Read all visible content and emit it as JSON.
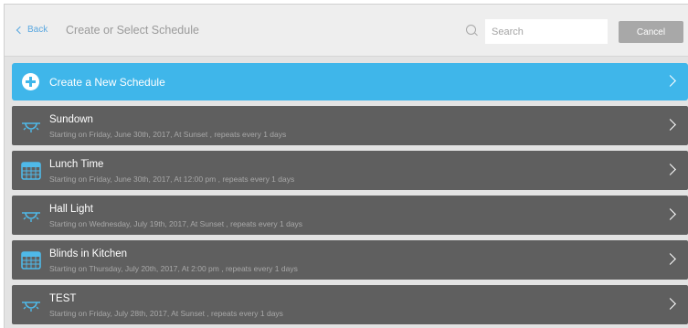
{
  "header": {
    "back_label": "Back",
    "title": "Create or Select Schedule",
    "search_placeholder": "Search",
    "cancel_label": "Cancel"
  },
  "create": {
    "label": "Create a New Schedule"
  },
  "schedules": [
    {
      "name": "Sundown",
      "detail": "Starting on Friday, June 30th, 2017, At Sunset , repeats every 1 days",
      "icon": "sunset-icon"
    },
    {
      "name": "Lunch Time",
      "detail": "Starting on Friday, June 30th, 2017, At 12:00 pm , repeats every 1 days",
      "icon": "calendar-icon"
    },
    {
      "name": "Hall Light",
      "detail": "Starting on Wednesday, July 19th, 2017, At Sunset , repeats every 1 days",
      "icon": "sunset-icon"
    },
    {
      "name": "Blinds in Kitchen",
      "detail": "Starting on Thursday, July 20th, 2017, At 2:00 pm , repeats every 1 days",
      "icon": "calendar-icon"
    },
    {
      "name": "TEST",
      "detail": "Starting on Friday, July 28th, 2017, At Sunset , repeats every 1 days",
      "icon": "sunset-icon"
    }
  ],
  "colors": {
    "accent": "#3fb6ea",
    "row_bg": "#5f5f5f",
    "back_link": "#5aa8e0"
  }
}
